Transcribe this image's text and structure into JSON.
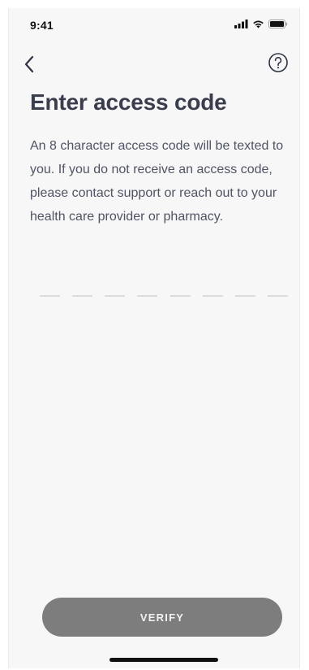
{
  "status_bar": {
    "time": "9:41",
    "icons": [
      "cellular-signal-icon",
      "wifi-icon",
      "battery-icon"
    ]
  },
  "nav": {
    "back_icon": "chevron-left-icon",
    "help_icon": "question-circle-icon"
  },
  "page": {
    "title": "Enter access code",
    "description": "An 8 character access code will be texted to you. If you do not receive an access code, please contact support or reach out to your health care provider or pharmacy."
  },
  "code_input": {
    "length": 8,
    "value": ""
  },
  "actions": {
    "verify_label": "VERIFY"
  },
  "colors": {
    "background": "#f7f7f8",
    "title": "#3a3d4d",
    "body_text": "#505463",
    "button_disabled": "#7d7d7d",
    "code_slot": "#dcdcdf"
  }
}
